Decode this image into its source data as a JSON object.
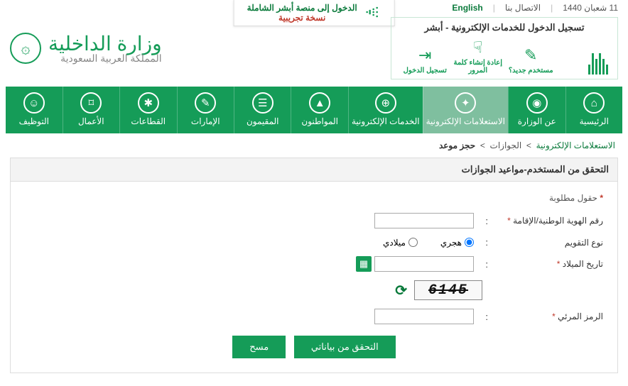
{
  "topbar": {
    "date": "11 شعبان 1440",
    "contact": "الاتصال بنا",
    "lang": "English"
  },
  "banner": {
    "line1": "الدخول إلى منصة أبشر الشاملة",
    "line2": "نسخة تجريبية"
  },
  "ministry": {
    "title": "وزارة الداخلية",
    "subtitle": "المملكة العربية السعودية"
  },
  "absher": {
    "title": "تسجيل الدخول للخدمات الإلكترونية - أبشر",
    "items": [
      {
        "label": "مستخدم جديد؟"
      },
      {
        "label": "إعادة إنشاء كلمة المرور"
      },
      {
        "label": "تسجيل الدخول"
      }
    ]
  },
  "nav": [
    {
      "label": "الرئيسية",
      "icon": "⌂"
    },
    {
      "label": "عن الوزارة",
      "icon": "◉"
    },
    {
      "label": "الاستعلامات الإلكترونية",
      "icon": "✦",
      "active": true
    },
    {
      "label": "الخدمات الإلكترونية",
      "icon": "⊕"
    },
    {
      "label": "المواطنون",
      "icon": "▲"
    },
    {
      "label": "المقيمون",
      "icon": "☰"
    },
    {
      "label": "الإمارات",
      "icon": "✎"
    },
    {
      "label": "القطاعات",
      "icon": "✱"
    },
    {
      "label": "الأعمال",
      "icon": "⌑"
    },
    {
      "label": "التوظيف",
      "icon": "☺"
    }
  ],
  "breadcrumb": {
    "root": "الاستعلامات الإلكترونية",
    "mid": "الجوازات",
    "current": "حجز موعد"
  },
  "panel": {
    "title": "التحقق من المستخدم-مواعيد الجوازات",
    "required_note": "حقول مطلوبة",
    "fields": {
      "id_label": "رقم الهوية الوطنية/الإقامة",
      "calendar_label": "نوع التقويم",
      "hijri": "هجري",
      "gregorian": "ميلادي",
      "dob_label": "تاريخ الميلاد",
      "captcha_label": "الرمز المرئي",
      "captcha_value": "6145"
    },
    "buttons": {
      "verify": "التحقق من بياناتي",
      "clear": "مسح"
    }
  }
}
